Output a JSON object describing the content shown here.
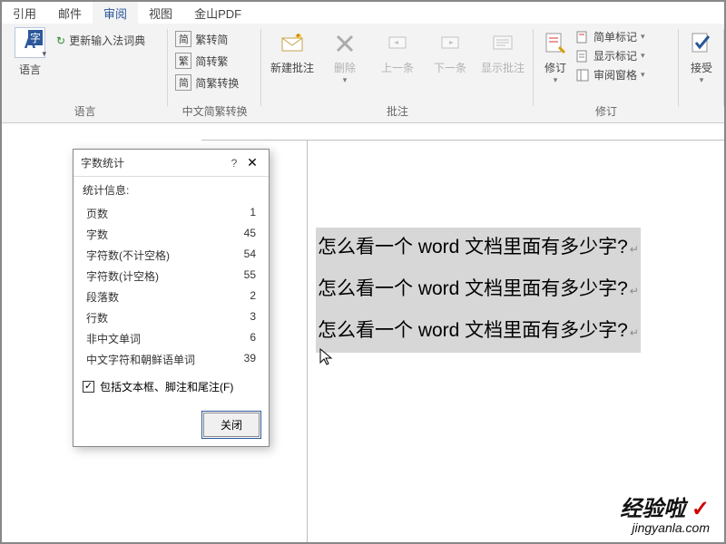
{
  "tabs": {
    "t1": "引用",
    "t2": "邮件",
    "t3": "审阅",
    "t4": "视图",
    "t5": "金山PDF"
  },
  "ribbon": {
    "lang_group_label": "语言",
    "lang_big_label": "语言",
    "lang_update_dict": "更新输入法词典",
    "conv_group_label": "中文简繁转换",
    "conv_s2t": "繁转简",
    "conv_t2s": "简转繁",
    "conv_mixed": "简繁转换",
    "annot_group_label": "批注",
    "annot_new": "新建批注",
    "annot_delete": "删除",
    "annot_prev": "上一条",
    "annot_next": "下一条",
    "annot_show": "显示批注",
    "track_group_label": "修订",
    "track_btn": "修订",
    "track_simple": "简单标记",
    "track_show": "显示标记",
    "track_pane": "审阅窗格",
    "accept_btn": "接受"
  },
  "dialog": {
    "title": "字数统计",
    "info_hdr": "统计信息:",
    "rows": {
      "pages_l": "页数",
      "pages_v": "1",
      "words_l": "字数",
      "words_v": "45",
      "chars_nospace_l": "字符数(不计空格)",
      "chars_nospace_v": "54",
      "chars_space_l": "字符数(计空格)",
      "chars_space_v": "55",
      "paras_l": "段落数",
      "paras_v": "2",
      "lines_l": "行数",
      "lines_v": "3",
      "noncjk_l": "非中文单词",
      "noncjk_v": "6",
      "cjk_l": "中文字符和朝鲜语单词",
      "cjk_v": "39"
    },
    "checkbox_label": "包括文本框、脚注和尾注(F)",
    "close_btn": "关闭"
  },
  "document": {
    "line": "怎么看一个 word 文档里面有多少字?"
  },
  "watermark": {
    "brand": "经验啦",
    "domain": "jingyanla.com"
  },
  "glyphs": {
    "simplified": "简",
    "traditional": "繁",
    "simplified2": "简"
  }
}
